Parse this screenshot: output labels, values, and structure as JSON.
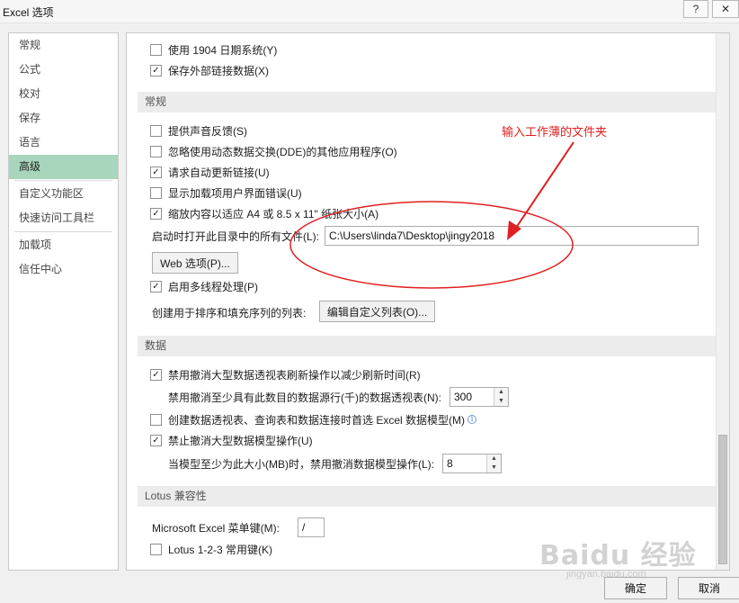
{
  "window": {
    "title": "Excel 选项",
    "help_glyph": "?",
    "close_glyph": "✕"
  },
  "sidebar": {
    "items": [
      "常规",
      "公式",
      "校对",
      "保存",
      "语言",
      "高级",
      "自定义功能区",
      "快速访问工具栏",
      "加载项",
      "信任中心"
    ],
    "active_index": 5
  },
  "top_options": [
    {
      "label": "使用 1904 日期系统(Y)",
      "checked": false
    },
    {
      "label": "保存外部链接数据(X)",
      "checked": true
    }
  ],
  "general": {
    "header": "常规",
    "options": [
      {
        "label": "提供声音反馈(S)",
        "checked": false
      },
      {
        "label": "忽略使用动态数据交换(DDE)的其他应用程序(O)",
        "checked": false
      },
      {
        "label": "请求自动更新链接(U)",
        "checked": true
      },
      {
        "label": "显示加载项用户界面错误(U)",
        "checked": false
      },
      {
        "label": "缩放内容以适应 A4 或 8.5 x 11\" 纸张大小(A)",
        "checked": true
      }
    ],
    "startup_label": "启动时打开此目录中的所有文件(L):",
    "startup_value": "C:\\Users\\linda7\\Desktop\\jingy2018",
    "web_options_button": "Web 选项(P)...",
    "multithread": {
      "label": "启用多线程处理(P)",
      "checked": true
    },
    "custom_list_label": "创建用于排序和填充序列的列表:",
    "custom_list_button": "编辑自定义列表(O)..."
  },
  "data_section": {
    "header": "数据",
    "disable_undo_refresh": {
      "label": "禁用撤消大型数据透视表刷新操作以减少刷新时间(R)",
      "checked": true
    },
    "rows_label": "禁用撤消至少具有此数目的数据源行(千)的数据透视表(N):",
    "rows_value": "300",
    "prefer_model": {
      "label": "创建数据透视表、查询表和数据连接时首选 Excel 数据模型(M)",
      "checked": false
    },
    "disable_undo_model": {
      "label": "禁止撤消大型数据模型操作(U)",
      "checked": true
    },
    "model_size_label": "当模型至少为此大小(MB)时，禁用撤消数据模型操作(L):",
    "model_size_value": "8"
  },
  "lotus": {
    "header": "Lotus 兼容性",
    "menu_key_label": "Microsoft Excel 菜单键(M):",
    "menu_key_value": "/",
    "nav_keys": {
      "label": "Lotus 1-2-3 常用键(K)",
      "checked": false
    }
  },
  "footer": {
    "ok": "确定",
    "cancel": "取消"
  },
  "annotation": {
    "text": "输入工作薄的文件夹",
    "color": "#e02020"
  },
  "watermark": {
    "logo": "Baidu 经验",
    "url": "jingyan.baidu.com"
  },
  "icons": {
    "check": "✓",
    "spin_up": "▲",
    "spin_down": "▼",
    "info": "i"
  }
}
